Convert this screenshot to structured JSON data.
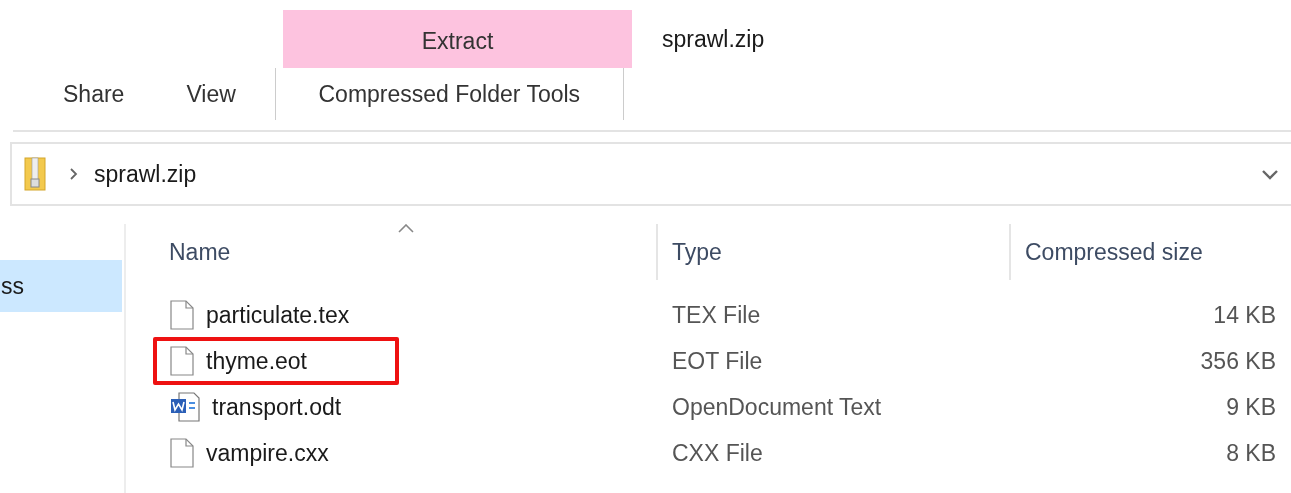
{
  "context_tab": {
    "label": "Extract"
  },
  "window": {
    "title": "sprawl.zip"
  },
  "ribbon_tabs": [
    {
      "label": "Share",
      "selected": false
    },
    {
      "label": "View",
      "selected": false
    },
    {
      "label": "Compressed Folder Tools",
      "selected": true
    }
  ],
  "address_bar": {
    "path": "sprawl.zip"
  },
  "sidebar": {
    "items": [
      {
        "label": "ss",
        "selected": true
      }
    ]
  },
  "table": {
    "columns": [
      "Name",
      "Type",
      "Compressed size"
    ],
    "rows": [
      {
        "name": "particulate.tex",
        "kind": "file",
        "type": "TEX File",
        "size": "14 KB",
        "highlighted": false
      },
      {
        "name": "thyme.eot",
        "kind": "file",
        "type": "EOT File",
        "size": "356 KB",
        "highlighted": true
      },
      {
        "name": "transport.odt",
        "kind": "document",
        "type": "OpenDocument Text",
        "size": "9 KB",
        "highlighted": false
      },
      {
        "name": "vampire.cxx",
        "kind": "file",
        "type": "CXX File",
        "size": "8 KB",
        "highlighted": false
      }
    ]
  }
}
